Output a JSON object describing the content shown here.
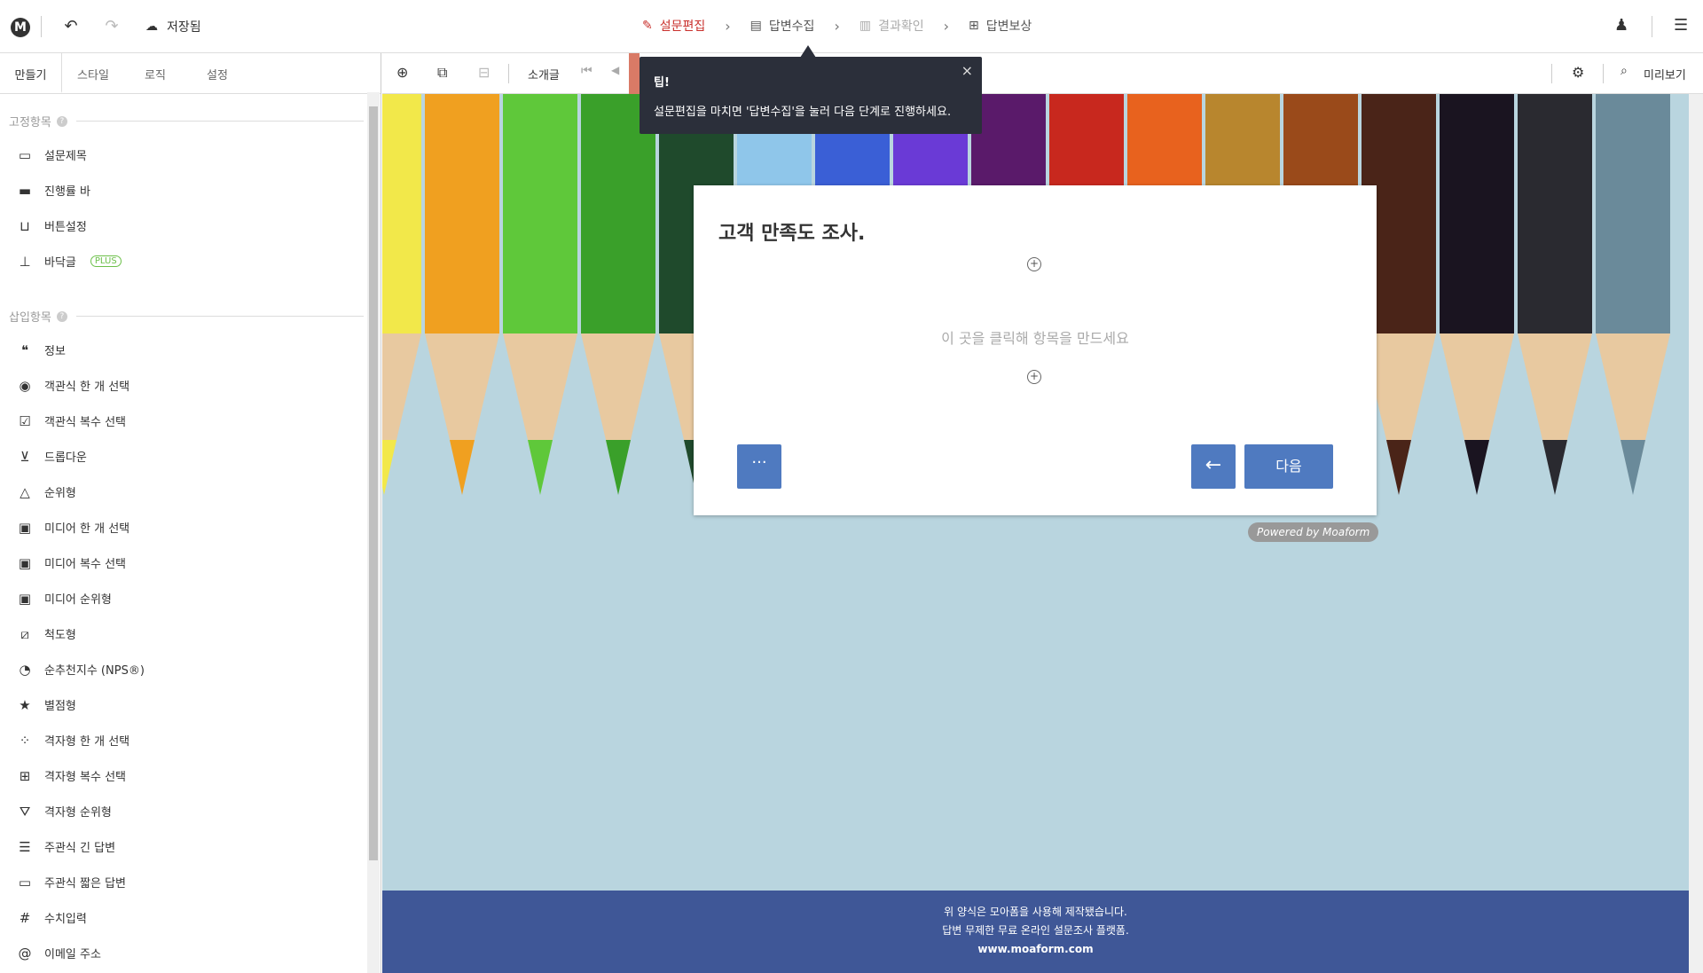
{
  "header": {
    "logo": "M",
    "saved_label": "저장됨",
    "steps": [
      {
        "label": "설문편집",
        "state": "active"
      },
      {
        "label": "답변수집",
        "state": "normal"
      },
      {
        "label": "결과확인",
        "state": "dim"
      },
      {
        "label": "답변보상",
        "state": "normal"
      }
    ]
  },
  "left_tabs": [
    "만들기",
    "스타일",
    "로직",
    "설정"
  ],
  "fixed_section": {
    "title": "고정항목"
  },
  "fixed_items": [
    "설문제목",
    "진행률 바",
    "버튼설정",
    "바닥글"
  ],
  "plus_badge": "PLUS",
  "insert_section": {
    "title": "삽입항목"
  },
  "insert_items": [
    "정보",
    "객관식 한 개 선택",
    "객관식 복수 선택",
    "드롭다운",
    "순위형",
    "미디어 한 개 선택",
    "미디어 복수 선택",
    "미디어 순위형",
    "척도형",
    "순추천지수 (NPS®)",
    "별점형",
    "격자형 한 개 선택",
    "격자형 복수 선택",
    "격자형 순위형",
    "주관식 긴 답변",
    "주관식 짧은 답변",
    "수치입력",
    "이메일 주소"
  ],
  "toolbar": {
    "intro_label": "소개글",
    "preview_label": "미리보기"
  },
  "tip": {
    "title": "팁!",
    "body": "설문편집을 마치면 '답변수집'을 눌러 다음 단계로 진행하세요."
  },
  "card": {
    "title": "고객 만족도 조사.",
    "placeholder": "이 곳을 클릭해 항목을 만드세요",
    "more_label": "···",
    "next_label": "다음"
  },
  "powered": "Powered by Moaform",
  "footer": {
    "line1": "위 양식은 모아폼을 사용해 제작됐습니다.",
    "line2": "답변 무제한 무료 온라인 설문조사 플랫폼.",
    "line3": "www.moaform.com"
  },
  "colors": {
    "accent": "#c9302c",
    "button": "#4f7ac0",
    "footer": "#3f5797",
    "background": "#b9d5df"
  }
}
